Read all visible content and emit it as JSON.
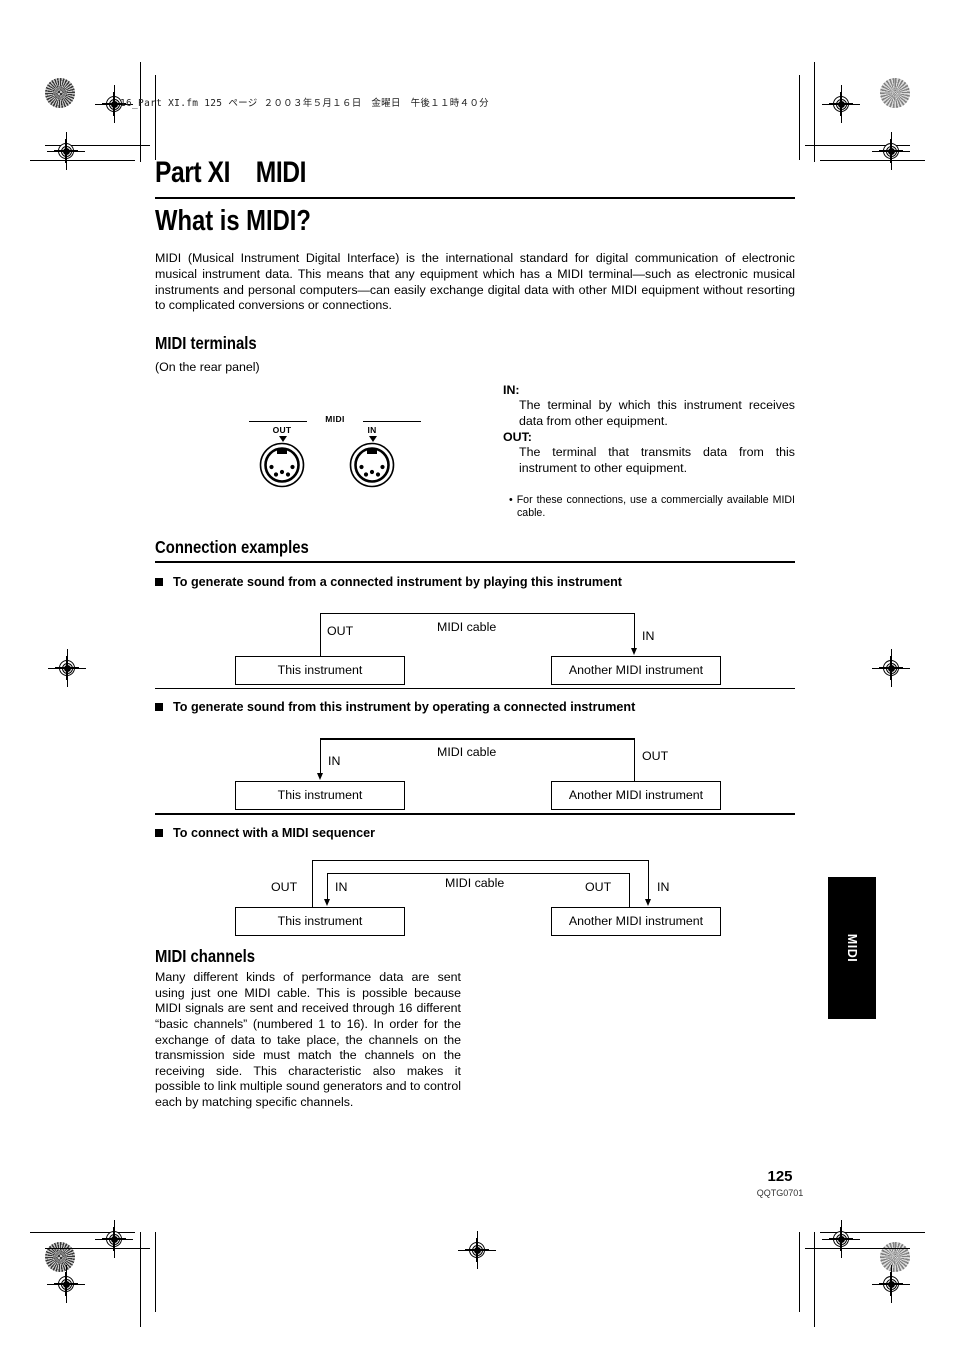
{
  "print_marks": {
    "fm_line": "16_Part XI.fm  125 ページ  ２００３年５月１６日　金曜日　午後１１時４０分"
  },
  "header": {
    "part_title": "Part XI    MIDI",
    "page_title": "What is MIDI?"
  },
  "intro": {
    "paragraph": "MIDI (Musical Instrument Digital Interface) is the international standard for digital communication of electronic musical instrument data. This means that any equipment which has a MIDI terminal—such as electronic musical instruments and personal computers—can easily exchange digital data with other MIDI equipment without resorting to complicated conversions or connections."
  },
  "terminals": {
    "heading": "MIDI terminals",
    "subtitle": "(On the rear panel)",
    "diagram": {
      "bracket_label": "MIDI",
      "jack_out_label": "OUT",
      "jack_in_label": "IN"
    },
    "in_term": "IN:",
    "in_desc": "The terminal by which this instrument receives data from other equipment.",
    "out_term": "OUT:",
    "out_desc": "The terminal that transmits data from this instrument to other equipment.",
    "note": "• For these connections, use a commercially available MIDI cable."
  },
  "connections": {
    "heading": "Connection examples",
    "examples": [
      {
        "subhead": "To generate sound from a connected instrument by playing this instrument",
        "left_box": "This instrument",
        "right_box": "Another MIDI instrument",
        "left_port": "OUT",
        "right_port": "IN",
        "cable_label": "MIDI cable"
      },
      {
        "subhead": "To generate sound from this instrument by operating a connected instrument",
        "left_box": "This instrument",
        "right_box": "Another MIDI instrument",
        "left_port": "IN",
        "right_port": "OUT",
        "cable_label": "MIDI cable"
      },
      {
        "subhead": "To connect with a MIDI sequencer",
        "left_box": "This instrument",
        "right_box": "Another MIDI instrument",
        "left_port_out": "OUT",
        "left_port_in": "IN",
        "right_port_out": "OUT",
        "right_port_in": "IN",
        "cable_label": "MIDI cable"
      }
    ]
  },
  "channels": {
    "heading": "MIDI channels",
    "paragraph": "Many different kinds of performance data are sent using just one MIDI cable. This is possible because MIDI signals are sent and received through 16 different “basic channels” (numbered 1 to 16). In order for the exchange of data to take place, the channels on the transmission side must match the channels on the receiving side. This characteristic also makes it possible to link multiple sound generators and to control each by matching specific channels."
  },
  "side_tab": {
    "label": "MIDI"
  },
  "footer": {
    "page_number": "125",
    "doc_code": "QQTG0701"
  }
}
